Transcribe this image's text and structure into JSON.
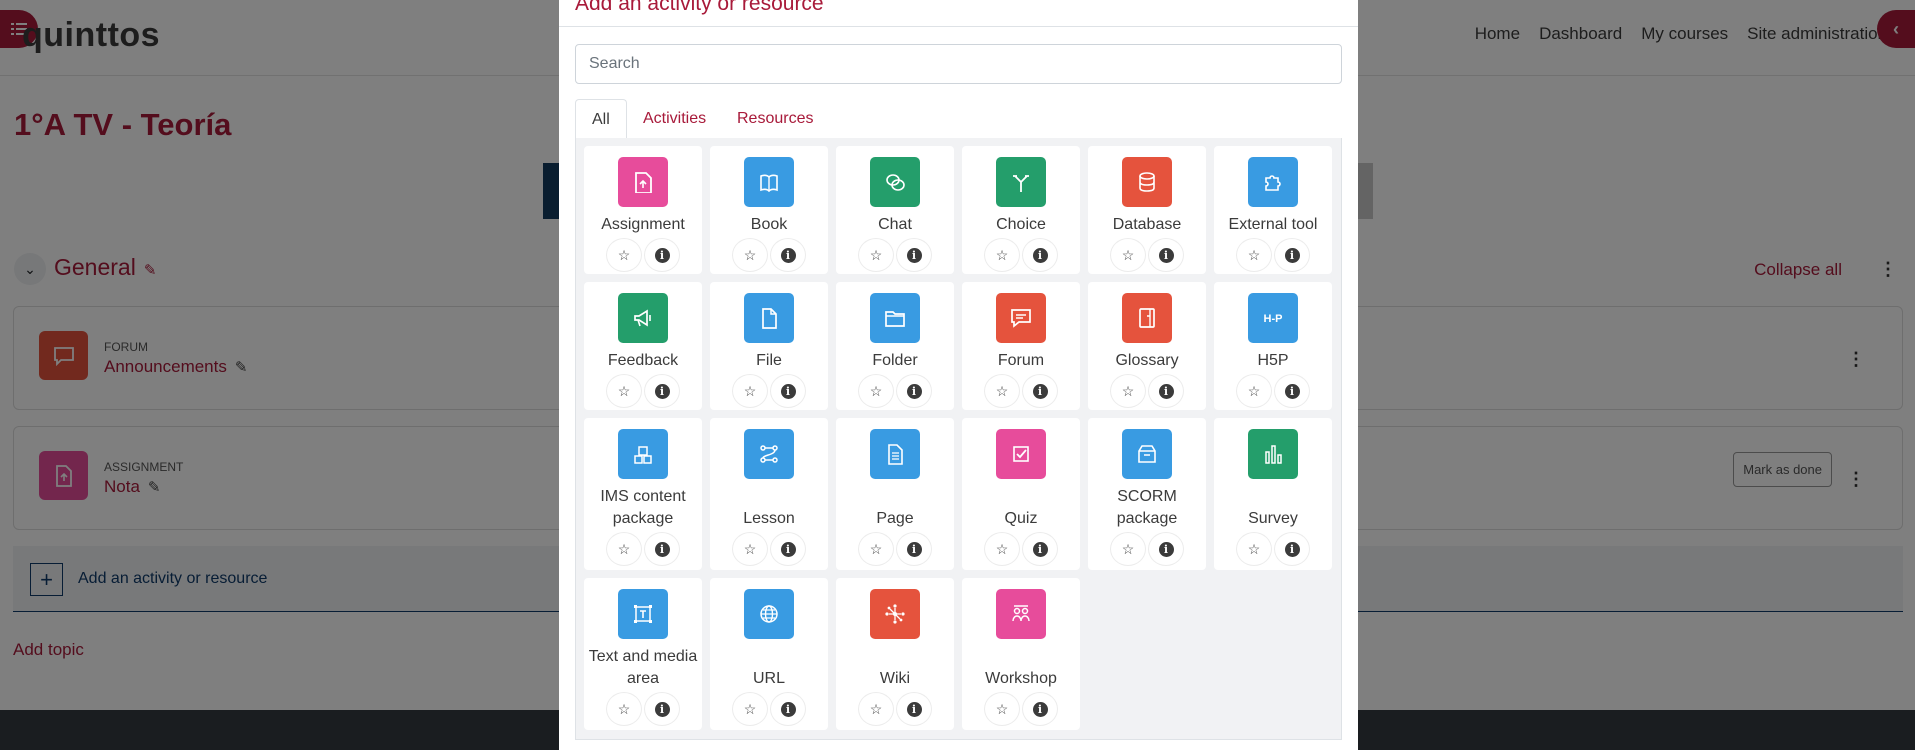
{
  "header": {
    "logo": "quinttos",
    "nav": [
      "Home",
      "Dashboard",
      "My courses",
      "Site administration"
    ]
  },
  "course": {
    "title": "1°A TV - Teoría",
    "section_title": "General",
    "collapse_all": "Collapse all",
    "activities": [
      {
        "type": "FORUM",
        "name": "Announcements",
        "color": "#e5533d"
      },
      {
        "type": "ASSIGNMENT",
        "name": "Nota",
        "color": "#e74c9b",
        "mark_done": "Mark as done"
      }
    ],
    "add_activity": "Add an activity or resource",
    "add_topic": "Add topic"
  },
  "modal": {
    "title": "Add an activity or resource",
    "search_placeholder": "Search",
    "tabs": [
      "All",
      "Activities",
      "Resources"
    ],
    "active_tab": "All",
    "items": [
      {
        "label": "Assignment",
        "icon": "assignment-icon",
        "color": "#e74c9b"
      },
      {
        "label": "Book",
        "icon": "book-icon",
        "color": "#399be2"
      },
      {
        "label": "Chat",
        "icon": "chat-icon",
        "color": "#249e6b"
      },
      {
        "label": "Choice",
        "icon": "choice-icon",
        "color": "#249e6b"
      },
      {
        "label": "Database",
        "icon": "database-icon",
        "color": "#e5533d"
      },
      {
        "label": "External tool",
        "icon": "external-tool-icon",
        "color": "#399be2"
      },
      {
        "label": "Feedback",
        "icon": "feedback-icon",
        "color": "#249e6b"
      },
      {
        "label": "File",
        "icon": "file-icon",
        "color": "#399be2"
      },
      {
        "label": "Folder",
        "icon": "folder-icon",
        "color": "#399be2"
      },
      {
        "label": "Forum",
        "icon": "forum-icon",
        "color": "#e5533d"
      },
      {
        "label": "Glossary",
        "icon": "glossary-icon",
        "color": "#e5533d"
      },
      {
        "label": "H5P",
        "icon": "h5p-icon",
        "color": "#399be2"
      },
      {
        "label": "IMS content package",
        "icon": "ims-package-icon",
        "color": "#399be2"
      },
      {
        "label": "Lesson",
        "icon": "lesson-icon",
        "color": "#399be2"
      },
      {
        "label": "Page",
        "icon": "page-icon",
        "color": "#399be2"
      },
      {
        "label": "Quiz",
        "icon": "quiz-icon",
        "color": "#e74c9b"
      },
      {
        "label": "SCORM package",
        "icon": "scorm-icon",
        "color": "#399be2"
      },
      {
        "label": "Survey",
        "icon": "survey-icon",
        "color": "#249e6b"
      },
      {
        "label": "Text and media area",
        "icon": "text-media-icon",
        "color": "#399be2"
      },
      {
        "label": "URL",
        "icon": "url-icon",
        "color": "#399be2"
      },
      {
        "label": "Wiki",
        "icon": "wiki-icon",
        "color": "#e5533d"
      },
      {
        "label": "Workshop",
        "icon": "workshop-icon",
        "color": "#e74c9b"
      }
    ]
  }
}
